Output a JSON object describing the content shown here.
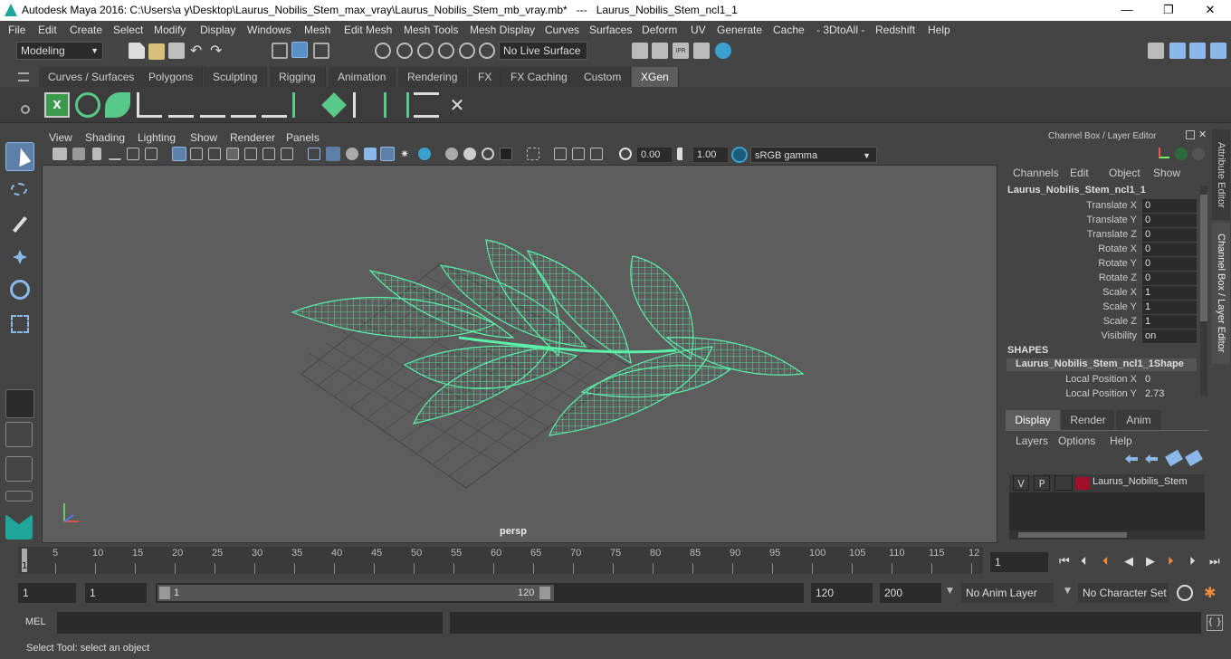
{
  "window": {
    "title": "Autodesk Maya 2016: C:\\Users\\a y\\Desktop\\Laurus_Nobilis_Stem_max_vray\\Laurus_Nobilis_Stem_mb_vray.mb*   ---   Laurus_Nobilis_Stem_ncl1_1",
    "minimize": "—",
    "maximize": "❐",
    "close": "✕"
  },
  "menus": [
    "File",
    "Edit",
    "Create",
    "Select",
    "Modify",
    "Display",
    "Windows",
    "Mesh",
    "Edit Mesh",
    "Mesh Tools",
    "Mesh Display",
    "Curves",
    "Surfaces",
    "Deform",
    "UV",
    "Generate",
    "Cache",
    "- 3DtoAll -",
    "Redshift",
    "Help"
  ],
  "statusline": {
    "mode": "Modeling",
    "live_surface": "No Live Surface"
  },
  "shelf_tabs": [
    "Curves / Surfaces",
    "Polygons",
    "Sculpting",
    "Rigging",
    "Animation",
    "Rendering",
    "FX",
    "FX Caching",
    "Custom",
    "XGen"
  ],
  "active_shelf_tab": "XGen",
  "viewport": {
    "menus": [
      "View",
      "Shading",
      "Lighting",
      "Show",
      "Renderer",
      "Panels"
    ],
    "exposure": "0.00",
    "gamma": "1.00",
    "color_space": "sRGB gamma",
    "camera": "persp"
  },
  "channel_box": {
    "title": "Channel Box / Layer Editor",
    "menus": [
      "Channels",
      "Edit",
      "Object",
      "Show"
    ],
    "object_name": "Laurus_Nobilis_Stem_ncl1_1",
    "attributes": [
      {
        "name": "Translate X",
        "value": "0"
      },
      {
        "name": "Translate Y",
        "value": "0"
      },
      {
        "name": "Translate Z",
        "value": "0"
      },
      {
        "name": "Rotate X",
        "value": "0"
      },
      {
        "name": "Rotate Y",
        "value": "0"
      },
      {
        "name": "Rotate Z",
        "value": "0"
      },
      {
        "name": "Scale X",
        "value": "1"
      },
      {
        "name": "Scale Y",
        "value": "1"
      },
      {
        "name": "Scale Z",
        "value": "1"
      },
      {
        "name": "Visibility",
        "value": "on"
      }
    ],
    "shapes_header": "SHAPES",
    "shape_name": "Laurus_Nobilis_Stem_ncl1_1Shape",
    "shape_attributes": [
      {
        "name": "Local Position X",
        "value": "0"
      },
      {
        "name": "Local Position Y",
        "value": "2.73"
      }
    ],
    "side_tabs": [
      "Attribute Editor",
      "Channel Box / Layer Editor"
    ]
  },
  "layer_editor": {
    "tabs": [
      "Display",
      "Render",
      "Anim"
    ],
    "active_tab": "Display",
    "menus": [
      "Layers",
      "Options",
      "Help"
    ],
    "layers": [
      {
        "v": "V",
        "p": "P",
        "name": "Laurus_Nobilis_Stem",
        "color": "#a0102a"
      }
    ]
  },
  "timeline": {
    "ticks": [
      "5",
      "10",
      "15",
      "20",
      "25",
      "30",
      "35",
      "40",
      "45",
      "50",
      "55",
      "60",
      "65",
      "70",
      "75",
      "80",
      "85",
      "90",
      "95",
      "100",
      "105",
      "110",
      "115",
      "12"
    ],
    "start_marker": "1",
    "current_frame": "1"
  },
  "range": {
    "start": "1",
    "playback_start": "1",
    "slider_start": "1",
    "slider_end": "120",
    "playback_end": "120",
    "end": "200",
    "anim_layer": "No Anim Layer",
    "character_set": "No Character Set"
  },
  "command_line": {
    "label": "MEL"
  },
  "help_line": "Select Tool: select an object",
  "colors": {
    "wireframe": "#5af0a8",
    "accent": "#5d5d5d"
  }
}
